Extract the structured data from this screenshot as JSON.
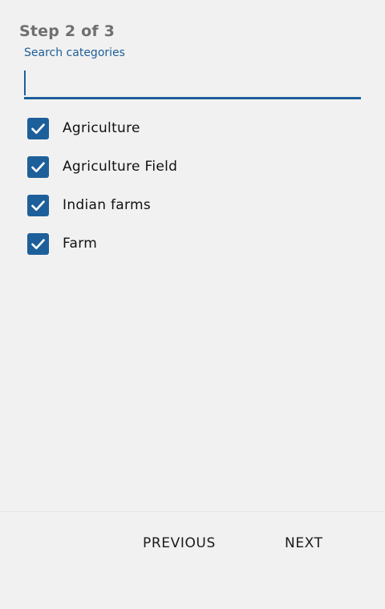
{
  "header": {
    "step": "Step 2 of 3"
  },
  "search": {
    "label": "Search categories",
    "value": "",
    "placeholder": ""
  },
  "categories": [
    {
      "label": "Agriculture",
      "checked": true
    },
    {
      "label": "Agriculture Field",
      "checked": true
    },
    {
      "label": "Indian farms",
      "checked": true
    },
    {
      "label": "Farm",
      "checked": true
    }
  ],
  "footer": {
    "previous_label": "PREVIOUS",
    "next_label": "NEXT"
  },
  "colors": {
    "accent": "#1d5f9a",
    "background": "#f1f1f1",
    "step_text": "#6f6f6f"
  },
  "icons": {
    "checkbox": "checkmark-icon"
  }
}
